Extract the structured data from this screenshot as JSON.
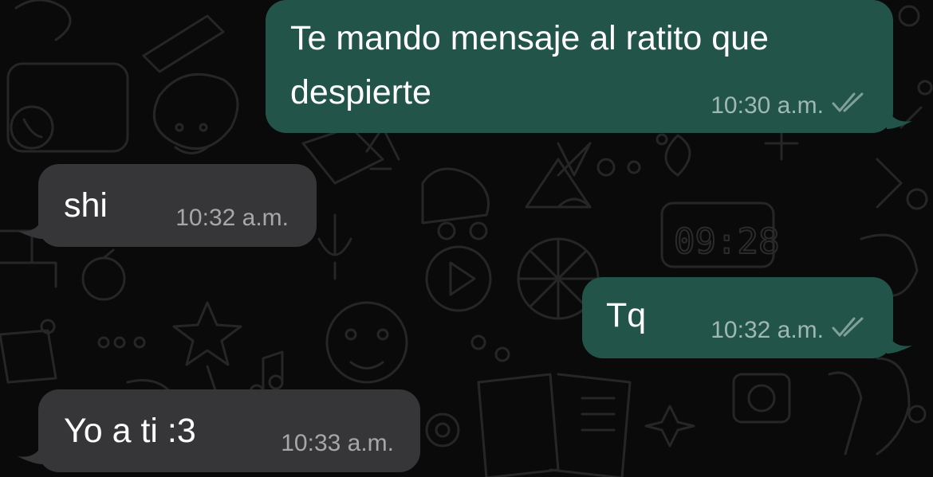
{
  "theme": {
    "background": "#0a0a0a",
    "outgoing_bubble": "#22544a",
    "incoming_bubble": "#363638",
    "text": "#ffffff",
    "outgoing_meta": "#9fb8b2",
    "incoming_meta": "#a7a7aa"
  },
  "wallpaper": {
    "clock_text": "09:28"
  },
  "messages": [
    {
      "direction": "outgoing",
      "text_lines": [
        "Te mando mensaje al ratito que",
        "despierte"
      ],
      "time": "10:30 a.m.",
      "status_icon": "double-check-icon"
    },
    {
      "direction": "incoming",
      "text": "shi",
      "time": "10:32 a.m."
    },
    {
      "direction": "outgoing",
      "text": "Tq",
      "time": "10:32 a.m.",
      "status_icon": "double-check-icon"
    },
    {
      "direction": "incoming",
      "text": "Yo a ti :3",
      "time": "10:33 a.m."
    }
  ]
}
